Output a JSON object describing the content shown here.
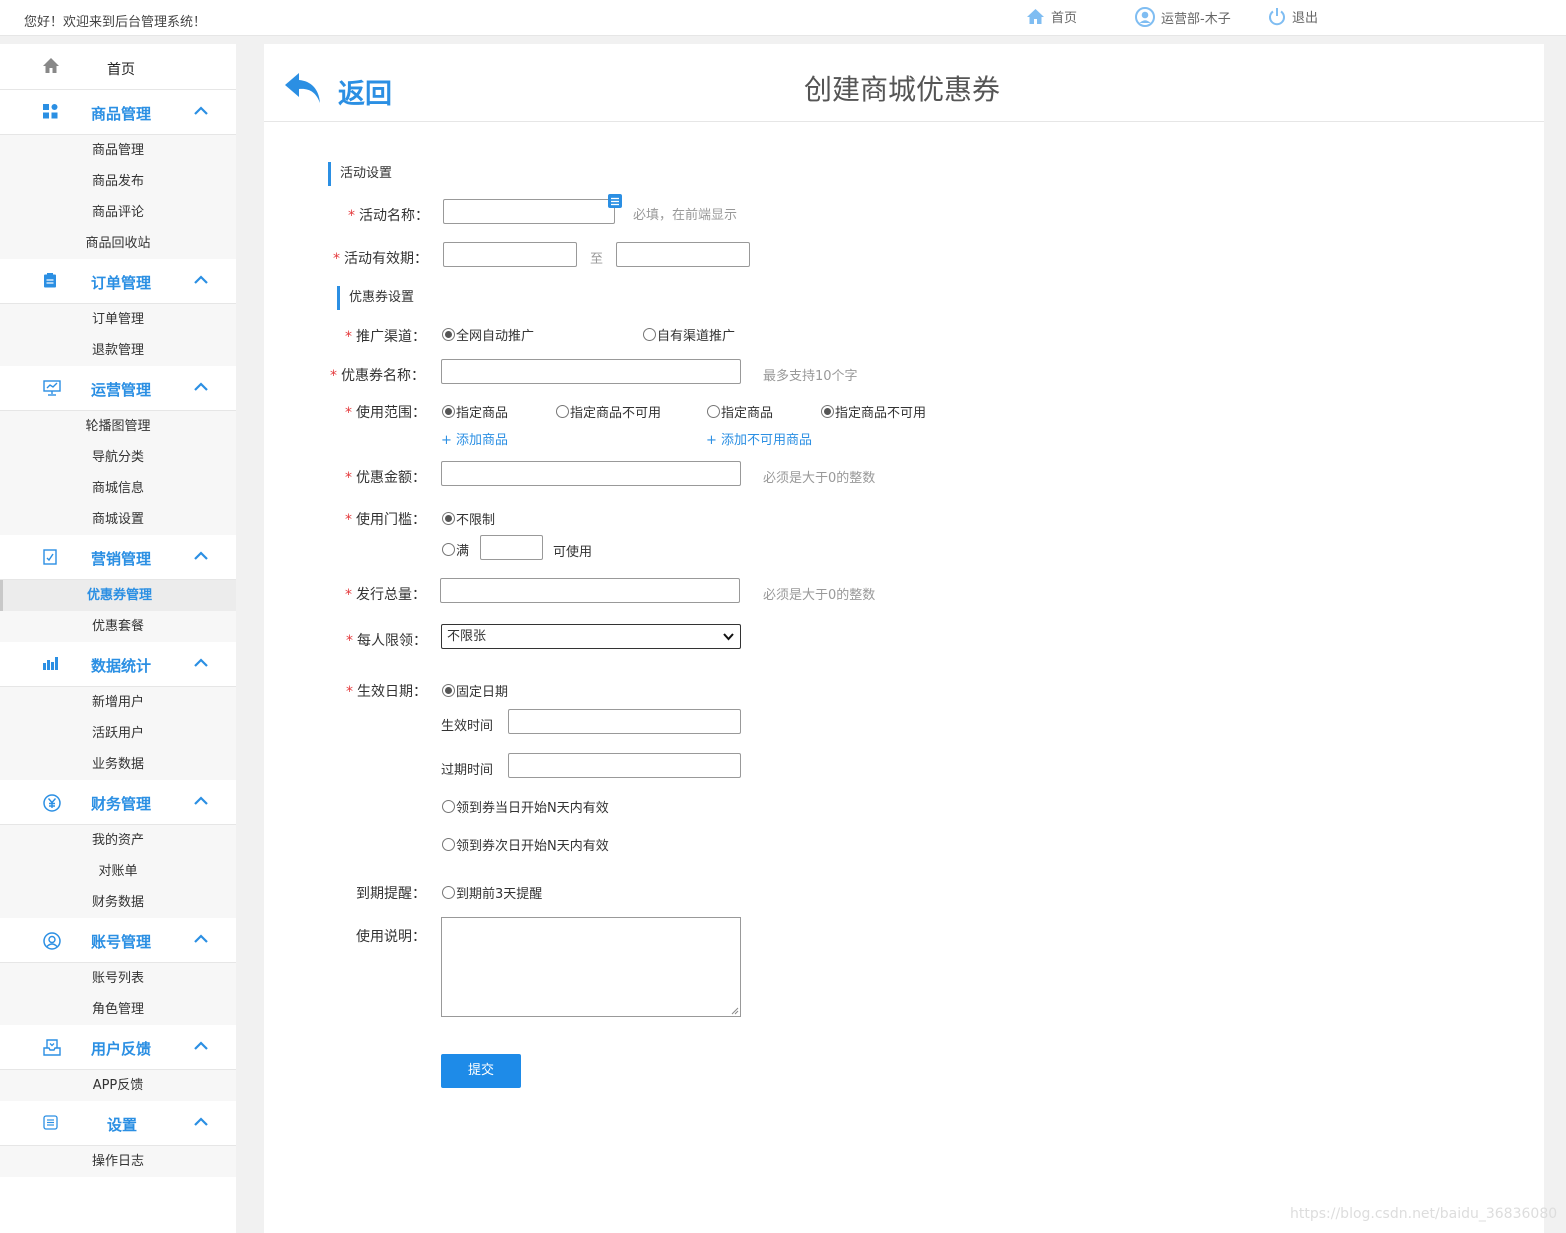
{
  "topbar": {
    "welcome": "您好！欢迎来到后台管理系统！",
    "home": "首页",
    "user": "运营部-木子",
    "logout": "退出"
  },
  "sidebar": {
    "home": "首页",
    "groups": [
      {
        "label": "商品管理",
        "icon": "grid-icon",
        "items": [
          "商品管理",
          "商品发布",
          "商品评论",
          "商品回收站"
        ]
      },
      {
        "label": "订单管理",
        "icon": "clipboard-icon",
        "items": [
          "订单管理",
          "退款管理"
        ]
      },
      {
        "label": "运营管理",
        "icon": "monitor-icon",
        "items": [
          "轮播图管理",
          "导航分类",
          "商城信息",
          "商城设置"
        ]
      },
      {
        "label": "营销管理",
        "icon": "checklist-icon",
        "items": [
          "优惠券管理",
          "优惠套餐"
        ]
      },
      {
        "label": "数据统计",
        "icon": "bar-chart-icon",
        "items": [
          "新增用户",
          "活跃用户",
          "业务数据"
        ]
      },
      {
        "label": "财务管理",
        "icon": "yen-icon",
        "items": [
          "我的资产",
          "对账单",
          "财务数据"
        ]
      },
      {
        "label": "账号管理",
        "icon": "user-circle-icon",
        "items": [
          "账号列表",
          "角色管理"
        ]
      },
      {
        "label": "用户反馈",
        "icon": "inbox-icon",
        "items": [
          "APP反馈"
        ]
      },
      {
        "label": "设置",
        "icon": "list-icon",
        "items": [
          "操作日志"
        ]
      }
    ]
  },
  "header": {
    "back": "返回",
    "title": "创建商城优惠券"
  },
  "form": {
    "section_activity": "活动设置",
    "activity_name_label": "活动名称：",
    "activity_name_hint": "必填，在前端显示",
    "activity_period_label": "活动有效期：",
    "to": "至",
    "section_coupon": "优惠券设置",
    "channel_label": "推广渠道：",
    "channel_all": "全网自动推广",
    "channel_own": "自有渠道推广",
    "coupon_name_label": "优惠券名称：",
    "coupon_name_hint": "最多支持10个字",
    "scope_label": "使用范围：",
    "scope_opts": [
      "指定商品",
      "指定商品不可用",
      "指定商品",
      "指定商品不可用"
    ],
    "add_goods": "+ 添加商品",
    "add_unavailable": "+ 添加不可用商品",
    "amount_label": "优惠金额：",
    "amount_hint": "必须是大于0的整数",
    "threshold_label": "使用门槛：",
    "threshold_none": "不限制",
    "threshold_full": "满",
    "threshold_usable": "可使用",
    "total_label": "发行总量：",
    "total_hint": "必须是大于0的整数",
    "limit_label": "每人限领：",
    "limit_value": "不限张",
    "effective_label": "生效日期：",
    "fixed_date": "固定日期",
    "start_time": "生效时间",
    "end_time": "过期时间",
    "same_day": "领到券当日开始N天内有效",
    "next_day": "领到券次日开始N天内有效",
    "remind_label": "到期提醒：",
    "remind_opt": "到期前3天提醒",
    "desc_label": "使用说明：",
    "submit": "提交"
  },
  "watermark": "https://blog.csdn.net/baidu_36836080",
  "colors": {
    "accent": "#2b8fe3",
    "required": "#e4393c",
    "button": "#1e8be8"
  }
}
